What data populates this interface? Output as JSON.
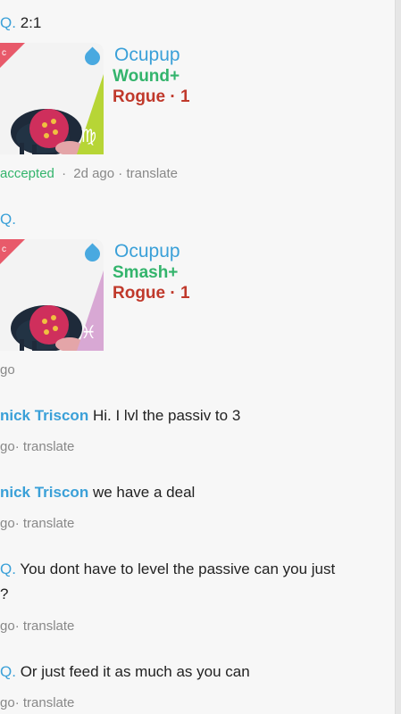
{
  "colors": {
    "link": "#3aa0d8",
    "accent_green": "#33b46c",
    "role_red": "#c0392b"
  },
  "messages": [
    {
      "id": "m1",
      "author_frag": "Q.",
      "text": "2:1"
    },
    {
      "id": "m2",
      "status": "accepted",
      "time": "2d ago",
      "translate": "translate"
    },
    {
      "id": "m3",
      "author_frag": "Q."
    },
    {
      "id": "m4",
      "time_frag": "go"
    },
    {
      "id": "m5",
      "author": "nick Triscon",
      "text": "Hi. I lvl the passiv to 3",
      "time_frag": "go",
      "translate": "translate"
    },
    {
      "id": "m6",
      "author": "nick Triscon",
      "text": "we have a deal",
      "time_frag": "go",
      "translate": "translate"
    },
    {
      "id": "m7",
      "author_frag": "Q.",
      "text": "You dont have to level the passive can you just",
      "text2": "?",
      "time_frag": "go",
      "translate": "translate"
    },
    {
      "id": "m8",
      "author_frag": "Q.",
      "text": "Or just feed it as much as you can",
      "time_frag": "go",
      "translate": "translate"
    }
  ],
  "cards": [
    {
      "name": "Ocupup",
      "move": "Wound+",
      "role": "Rogue · 1",
      "corner": "c",
      "zodiac_icon": "virgo-icon",
      "zodiac_glyph": "♍",
      "element_icon": "water-drop-icon"
    },
    {
      "name": "Ocupup",
      "move": "Smash+",
      "role": "Rogue · 1",
      "corner": "c",
      "zodiac_icon": "pisces-icon",
      "zodiac_glyph": "♓",
      "element_icon": "water-drop-icon"
    }
  ]
}
